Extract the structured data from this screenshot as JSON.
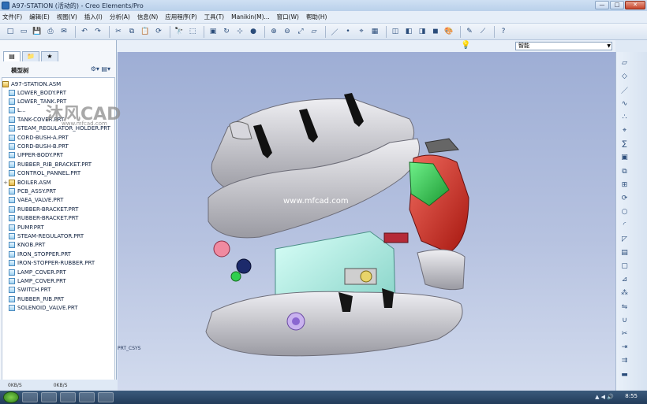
{
  "window": {
    "title": "A97-STATION (活动的) - Creo Elements/Pro",
    "controls": [
      "—",
      "□",
      "✕"
    ]
  },
  "menu": [
    "文件(F)",
    "编辑(E)",
    "视图(V)",
    "插入(I)",
    "分析(A)",
    "信息(N)",
    "应用程序(P)",
    "工具(T)",
    "Manikin(M)...",
    "窗口(W)",
    "帮助(H)"
  ],
  "toolbar": {
    "icons": [
      "new-icon",
      "open-icon",
      "save-icon",
      "print-icon",
      "email-icon",
      "undo-icon",
      "redo-icon",
      "cut-icon",
      "copy-icon",
      "paste-icon",
      "regenerate-icon",
      "find-icon",
      "select-icon",
      "repaint-icon",
      "spin-icon",
      "orient-icon",
      "shade-icon",
      "zoom-in-icon",
      "zoom-out-icon",
      "refit-icon",
      "datum-planes-icon",
      "datum-axes-icon",
      "datum-points-icon",
      "csys-icon",
      "view-manager-icon",
      "wireframe-icon",
      "hidden-line-icon",
      "no-hidden-icon",
      "shading-icon",
      "appearance-icon",
      "sketch-icon",
      "analysis-icon",
      "help-icon"
    ]
  },
  "filter": {
    "value": "智能"
  },
  "left_panel": {
    "tabs": [
      "model-tree-tab",
      "folder-tab",
      "favorites-tab"
    ],
    "tree_header": "模型树",
    "root": "A97-STATION.ASM",
    "items": [
      {
        "label": "LOWER_BODY.PRT",
        "type": "part"
      },
      {
        "label": "LOWER_TANK.PRT",
        "type": "part"
      },
      {
        "label": "L...",
        "type": "part"
      },
      {
        "label": "TANK-COVER.PRT",
        "type": "part"
      },
      {
        "label": "STEAM_REGULATOR_HOLDER.PRT",
        "type": "part"
      },
      {
        "label": "CORD-BUSH-A.PRT",
        "type": "part"
      },
      {
        "label": "CORD-BUSH-B.PRT",
        "type": "part"
      },
      {
        "label": "UPPER-BODY.PRT",
        "type": "part"
      },
      {
        "label": "RUBBER_RIB_BRACKET.PRT",
        "type": "part"
      },
      {
        "label": "CONTROL_PANNEL.PRT",
        "type": "part"
      },
      {
        "label": "BOILER.ASM",
        "type": "asm"
      },
      {
        "label": "PCB_ASSY.PRT",
        "type": "part"
      },
      {
        "label": "VAEA_VALVE.PRT",
        "type": "part"
      },
      {
        "label": "RUBBER-BRACKET.PRT",
        "type": "part"
      },
      {
        "label": "RUBBER-BRACKET.PRT",
        "type": "part"
      },
      {
        "label": "PUMP.PRT",
        "type": "part"
      },
      {
        "label": "STEAM-REGULATOR.PRT",
        "type": "part"
      },
      {
        "label": "KNOB.PRT",
        "type": "part"
      },
      {
        "label": "IRON_STOPPER.PRT",
        "type": "part"
      },
      {
        "label": "IRON-STOPPER-RUBBER.PRT",
        "type": "part"
      },
      {
        "label": "LAMP_COVER.PRT",
        "type": "part"
      },
      {
        "label": "LAMP_COVER.PRT",
        "type": "part"
      },
      {
        "label": "SWITCH.PRT",
        "type": "part"
      },
      {
        "label": "RUBBER_RIB.PRT",
        "type": "part"
      },
      {
        "label": "SOLENOID_VALVE.PRT",
        "type": "part"
      }
    ],
    "status_left": "0KB/S",
    "status_right": "0KB/S"
  },
  "viewport": {
    "units_label": "PRT_CSYS",
    "watermark_url": "www.mfcad.com"
  },
  "logo": {
    "brand": "沐风CAD",
    "url": "www.mfcad.com"
  },
  "right_toolbar": {
    "icons": [
      "datum-plane-icon",
      "sketched-curve-icon",
      "datum-axis-icon",
      "curve-icon",
      "datum-point-icon",
      "csys-icon",
      "analysis-icon",
      "component-icon",
      "assemble-icon",
      "create-component-icon",
      "repeat-icon",
      "hole-icon",
      "round-icon",
      "chamfer-icon",
      "rib-icon",
      "shell-icon",
      "draft-icon",
      "pattern-icon",
      "mirror-icon",
      "merge-icon",
      "trim-icon",
      "extend-icon",
      "offset-icon",
      "thicken-icon"
    ]
  },
  "taskbar": {
    "time": "8:55"
  },
  "colors": {
    "viewport_top": "#9eaed5",
    "viewport_bottom": "#d2dbee",
    "part_gray": "#c8c8cc",
    "part_green": "#2fcf4f",
    "part_red": "#d8322a",
    "part_teal": "#9fe8dc"
  }
}
